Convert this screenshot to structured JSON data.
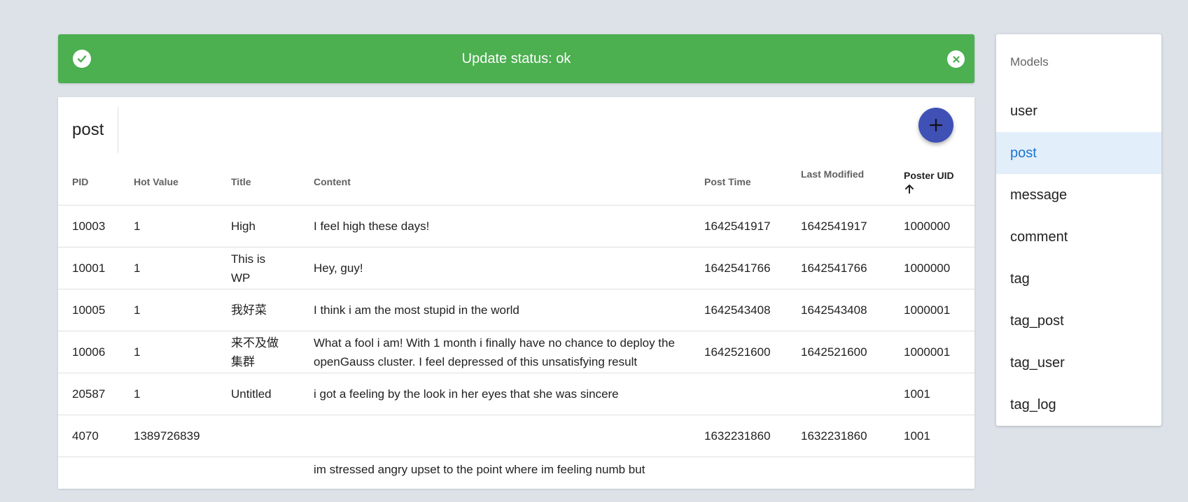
{
  "alert": {
    "text": "Update status: ok"
  },
  "table": {
    "title": "post",
    "columns": [
      "PID",
      "Hot Value",
      "Title",
      "Content",
      "Post Time",
      "Last Modified",
      "Poster UID"
    ],
    "sorted_column": "Poster UID",
    "sort_direction": "ascending",
    "rows": [
      [
        "10003",
        "1",
        "High",
        "I feel high these days!",
        "1642541917",
        "1642541917",
        "1000000"
      ],
      [
        "10001",
        "1",
        "This is WP",
        "Hey, guy!",
        "1642541766",
        "1642541766",
        "1000000"
      ],
      [
        "10005",
        "1",
        "我好菜",
        "I think i am the most stupid in the world",
        "1642543408",
        "1642543408",
        "1000001"
      ],
      [
        "10006",
        "1",
        "来不及做集群",
        "What a fool i am! With 1 month i finally have no chance to deploy the openGauss cluster. I feel depressed of this unsatisfying result",
        "1642521600",
        "1642521600",
        "1000001"
      ],
      [
        "20587",
        "1",
        "Untitled",
        "i got a feeling by the look in her eyes that she was sincere",
        "",
        "",
        "1001"
      ],
      [
        "4070",
        "1389726839",
        "",
        "",
        "1632231860",
        "1632231860",
        "1001"
      ],
      [
        "",
        "",
        "",
        "im stressed angry upset to the point where im feeling numb but",
        "",
        "",
        ""
      ]
    ]
  },
  "sidebar": {
    "header": "Models",
    "items": [
      "user",
      "post",
      "message",
      "comment",
      "tag",
      "tag_post",
      "tag_user",
      "tag_log"
    ],
    "active": "post"
  },
  "colors": {
    "alert_bg": "#4caf50",
    "fab_bg": "#3f51b5",
    "active_item_bg": "#e3eefb",
    "active_item_text": "#1976d2"
  },
  "icons": {
    "alert_status": "check-circle-icon",
    "alert_close": "close-circle-icon",
    "add": "plus-icon",
    "sort": "arrow-up-icon"
  }
}
